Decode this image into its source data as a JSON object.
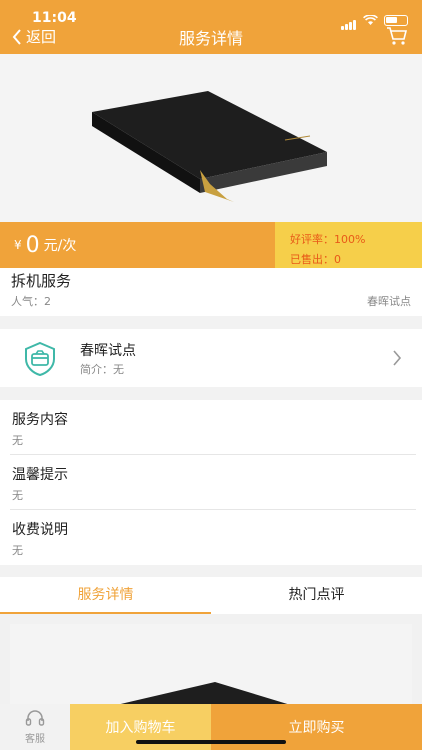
{
  "status_bar": {
    "time": "11:04"
  },
  "nav": {
    "back_label": "返回",
    "title": "服务详情",
    "cart_icon": "cart-icon"
  },
  "price": {
    "currency": "¥",
    "amount": "0",
    "unit": "元/次",
    "rating_label": "好评率：",
    "rating_value": "100%",
    "sold_label": "已售出：",
    "sold_value": "0"
  },
  "service": {
    "name": "拆机服务",
    "popularity_label": "人气：",
    "popularity_value": "2",
    "tag": "春晖试点"
  },
  "shop": {
    "name": "春晖试点",
    "intro_label": "简介：",
    "intro_value": "无",
    "icon": "shop-shield-icon"
  },
  "details": [
    {
      "title": "服务内容",
      "value": "无"
    },
    {
      "title": "温馨提示",
      "value": "无"
    },
    {
      "title": "收费说明",
      "value": "无"
    }
  ],
  "tabs": [
    {
      "label": "服务详情",
      "active": true
    },
    {
      "label": "热门点评",
      "active": false
    }
  ],
  "bottom_bar": {
    "service_label": "客服",
    "add_cart_label": "加入购物车",
    "buy_label": "立即购买"
  },
  "colors": {
    "accent": "#f0a33a",
    "rating_bg": "#f6cf4a",
    "rating_text": "#e85a18",
    "add_cart_bg": "#f7cf62"
  }
}
